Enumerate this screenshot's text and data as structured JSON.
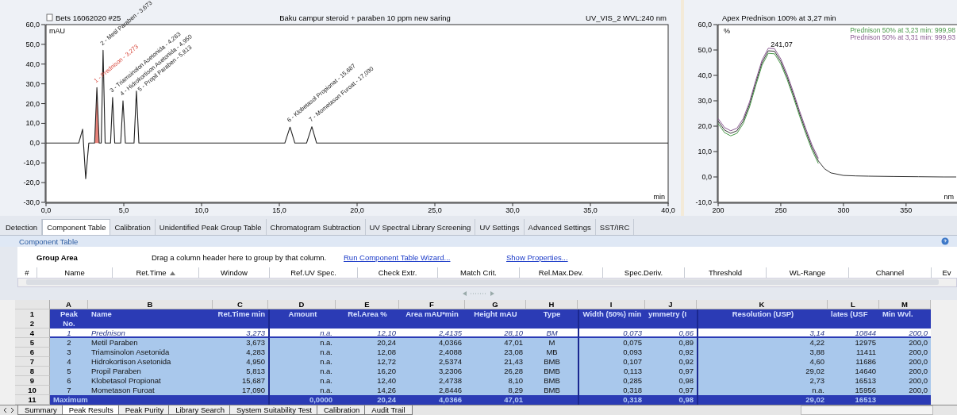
{
  "chromatogram": {
    "sample": "Bets 16062020 #25",
    "title": "Baku campur steroid + paraben 10 ppm new saring",
    "channel": "UV_VIS_2 WVL:240 nm",
    "chart_data": {
      "type": "line",
      "xlabel": "min",
      "ylabel": "mAU",
      "xlim": [
        0,
        40
      ],
      "ylim": [
        -30,
        60
      ],
      "xticks": [
        {
          "value": 0,
          "label": "0,0"
        },
        {
          "value": 5,
          "label": "5,0"
        },
        {
          "value": 10,
          "label": "10,0"
        },
        {
          "value": 15,
          "label": "15,0"
        },
        {
          "value": 20,
          "label": "20,0"
        },
        {
          "value": 25,
          "label": "25,0"
        },
        {
          "value": 30,
          "label": "30,0"
        },
        {
          "value": 35,
          "label": "35,0"
        },
        {
          "value": 40,
          "label": "40,0"
        }
      ],
      "yticks": [
        {
          "value": 60,
          "label": "60,0"
        },
        {
          "value": 50,
          "label": "50,0"
        },
        {
          "value": 40,
          "label": "40,0"
        },
        {
          "value": 30,
          "label": "30,0"
        },
        {
          "value": 20,
          "label": "20,0"
        },
        {
          "value": 10,
          "label": "10,0"
        },
        {
          "value": 0,
          "label": "0,0"
        },
        {
          "value": -10,
          "label": "-10,0"
        },
        {
          "value": -20,
          "label": "-20,0"
        },
        {
          "value": -30,
          "label": "-30,0"
        }
      ],
      "x": [
        0,
        2.1,
        2.35,
        2.55,
        2.75,
        3.12,
        3.27,
        3.42,
        3.55,
        3.67,
        3.8,
        4.15,
        4.28,
        4.42,
        4.8,
        4.95,
        5.1,
        5.66,
        5.81,
        5.97,
        15.35,
        15.69,
        16.0,
        16.75,
        17.09,
        17.4,
        40
      ],
      "series": [
        {
          "color": "#222222",
          "values": [
            0,
            0,
            7,
            -18,
            0,
            0,
            28.1,
            0,
            0,
            47.0,
            0,
            0,
            23.1,
            0,
            0,
            21.4,
            0,
            0,
            26.3,
            0,
            0,
            8.1,
            0,
            0,
            8.3,
            0,
            0
          ]
        }
      ],
      "annotations": [
        {
          "x": 3.27,
          "y": 28.1,
          "text": "1 - Prednison - 3,273"
        },
        {
          "x": 3.67,
          "y": 47.0,
          "text": "2 - Metil Paraben - 3,673"
        },
        {
          "x": 4.28,
          "y": 23.1,
          "text": "3 - Triamsinolon Asetonida - 4,283"
        },
        {
          "x": 4.95,
          "y": 21.4,
          "text": "4 - Hidrokortison Asetonida - 4,950"
        },
        {
          "x": 5.81,
          "y": 26.3,
          "text": "5 - Propil Paraben - 5,813"
        },
        {
          "x": 15.69,
          "y": 8.1,
          "text": "6 - Klobetasol Propionat - 15,687"
        },
        {
          "x": 17.09,
          "y": 8.3,
          "text": "7 - Mometason Furoat - 17,090"
        }
      ]
    },
    "peaks": [
      {
        "selected": true
      },
      {
        "selected": false
      },
      {
        "selected": false
      },
      {
        "selected": false
      },
      {
        "selected": false
      },
      {
        "selected": false
      },
      {
        "selected": false
      }
    ]
  },
  "spectrum": {
    "chart_data": {
      "type": "line",
      "title": "Apex Prednison 100% at 3,27 min",
      "xlabel": "nm",
      "ylabel": "%",
      "xlim": [
        200,
        390
      ],
      "ylim": [
        -10,
        60
      ],
      "xticks": [
        {
          "value": 200,
          "label": "200"
        },
        {
          "value": 250,
          "label": "250"
        },
        {
          "value": 300,
          "label": "300"
        },
        {
          "value": 350,
          "label": "350"
        }
      ],
      "yticks": [
        {
          "value": 60,
          "label": "60,0"
        },
        {
          "value": 50,
          "label": "50,0"
        },
        {
          "value": 40,
          "label": "40,0"
        },
        {
          "value": 30,
          "label": "30,0"
        },
        {
          "value": 20,
          "label": "20,0"
        },
        {
          "value": 10,
          "label": "10,0"
        },
        {
          "value": 0,
          "label": "0,0"
        },
        {
          "value": -10,
          "label": "-10,0"
        }
      ],
      "x": [
        200,
        205,
        210,
        215,
        220,
        225,
        230,
        235,
        240,
        245,
        250,
        255,
        260,
        265,
        270,
        275,
        280,
        285,
        290,
        300,
        310,
        320,
        340,
        360,
        380,
        390
      ],
      "series": [
        {
          "color": "#333333",
          "values": [
            22,
            18.5,
            17.2,
            18.2,
            22,
            28.5,
            37,
            45,
            49.7,
            49.5,
            45.5,
            39.5,
            32.5,
            25,
            18,
            11.5,
            6.3,
            3.2,
            1.6,
            0.6,
            0.4,
            0.3,
            0.2,
            0.1,
            0,
            0
          ]
        },
        {
          "name": "Prednison 50% at 3,23 min: 999,98",
          "color": "#4a9a4a",
          "values": [
            21,
            17.5,
            16.2,
            17.2,
            21,
            27.5,
            36,
            44,
            48.7,
            48.5,
            44.5,
            38.5,
            31.5,
            24,
            17,
            10.5,
            5.3,
            null,
            null,
            null,
            null,
            null,
            null,
            null,
            null,
            null
          ]
        },
        {
          "name": "Prednison 50% at 3,31 min: 999,93",
          "color": "#8a5a92",
          "values": [
            23,
            19.5,
            18.2,
            19.2,
            23,
            29.5,
            38,
            46,
            50.7,
            50.5,
            46.5,
            40.5,
            33.5,
            26,
            19,
            12.5,
            7.3,
            null,
            null,
            null,
            null,
            null,
            null,
            null,
            null,
            null
          ]
        }
      ],
      "annotations": [
        {
          "x": 242,
          "y": 50,
          "text": "241,07"
        }
      ]
    }
  },
  "tabs": [
    {
      "label": "Detection",
      "selected": false
    },
    {
      "label": "Component Table",
      "selected": true
    },
    {
      "label": "Calibration",
      "selected": false
    },
    {
      "label": "Unidentified Peak Group Table",
      "selected": false
    },
    {
      "label": "Chromatogram Subtraction",
      "selected": false
    },
    {
      "label": "UV Spectral Library Screening",
      "selected": false
    },
    {
      "label": "UV Settings",
      "selected": false
    },
    {
      "label": "Advanced Settings",
      "selected": false
    },
    {
      "label": "SST/IRC",
      "selected": false
    }
  ],
  "component_table": {
    "title": "Component Table",
    "group_area": "Group Area",
    "group_hint": "Drag a column header here to group by that column.",
    "links": [
      "Run Component Table Wizard...",
      "Show Properties..."
    ],
    "columns": [
      {
        "label": "#",
        "sorted": false
      },
      {
        "label": "Name",
        "sorted": false
      },
      {
        "label": "Ret.Time",
        "sorted": true
      },
      {
        "label": "Window",
        "sorted": false
      },
      {
        "label": "Ref.UV Spec.",
        "sorted": false
      },
      {
        "label": "Check Extr.",
        "sorted": false
      },
      {
        "label": "Match Crit.",
        "sorted": false
      },
      {
        "label": "Rel.Max.Dev.",
        "sorted": false
      },
      {
        "label": "Spec.Deriv.",
        "sorted": false
      },
      {
        "label": "Threshold",
        "sorted": false
      },
      {
        "label": "WL-Range",
        "sorted": false
      },
      {
        "label": "Channel",
        "sorted": false
      },
      {
        "label": "Ev",
        "sorted": false
      }
    ]
  },
  "results": {
    "column_letters": [
      "A",
      "B",
      "C",
      "D",
      "E",
      "F",
      "G",
      "H",
      "I",
      "J",
      "K",
      "L",
      "M"
    ],
    "header_row_numbers": [
      "1",
      "2"
    ],
    "headers": [
      [
        "Peak",
        "No."
      ],
      [
        "Name"
      ],
      [
        "Ret.Time",
        "min"
      ],
      [
        "Amount"
      ],
      [
        "Rel.Area",
        "%"
      ],
      [
        "Area",
        "mAU*min"
      ],
      [
        "Height",
        "mAU"
      ],
      [
        "Type"
      ],
      [
        "Width (50%)",
        "min"
      ],
      [
        "ymmetry (I"
      ],
      [
        "Resolution (USP)"
      ],
      [
        "lates (USF"
      ],
      [
        "Min Wvl."
      ]
    ],
    "rows": [
      {
        "number": "4",
        "selected": true,
        "cells": [
          "1",
          "Prednison",
          "3,273",
          "n.a.",
          "12,10",
          "2,4135",
          "28,10",
          "BM",
          "0,073",
          "0,86",
          "3,14",
          "10844",
          "200,0"
        ]
      },
      {
        "number": "5",
        "selected": false,
        "cells": [
          "2",
          "Metil Paraben",
          "3,673",
          "n.a.",
          "20,24",
          "4,0366",
          "47,01",
          "M",
          "0,075",
          "0,89",
          "4,22",
          "12975",
          "200,0"
        ]
      },
      {
        "number": "6",
        "selected": false,
        "cells": [
          "3",
          "Triamsinolon Asetonida",
          "4,283",
          "n.a.",
          "12,08",
          "2,4088",
          "23,08",
          "MB",
          "0,093",
          "0,92",
          "3,88",
          "11411",
          "200,0"
        ]
      },
      {
        "number": "7",
        "selected": false,
        "cells": [
          "4",
          "Hidrokortison Asetonida",
          "4,950",
          "n.a.",
          "12,72",
          "2,5374",
          "21,43",
          "BMB",
          "0,107",
          "0,92",
          "4,60",
          "11686",
          "200,0"
        ]
      },
      {
        "number": "8",
        "selected": false,
        "cells": [
          "5",
          "Propil Paraben",
          "5,813",
          "n.a.",
          "16,20",
          "3,2306",
          "26,28",
          "BMB",
          "0,113",
          "0,97",
          "29,02",
          "14640",
          "200,0"
        ]
      },
      {
        "number": "9",
        "selected": false,
        "cells": [
          "6",
          "Klobetasol Propionat",
          "15,687",
          "n.a.",
          "12,40",
          "2,4738",
          "8,10",
          "BMB",
          "0,285",
          "0,98",
          "2,73",
          "16513",
          "200,0"
        ]
      },
      {
        "number": "10",
        "selected": false,
        "cells": [
          "7",
          "Mometason Furoat",
          "17,090",
          "n.a.",
          "14,26",
          "2,8446",
          "8,29",
          "BMB",
          "0,318",
          "0,97",
          "n.a.",
          "15956",
          "200,0"
        ]
      }
    ],
    "maximum": {
      "number": "11",
      "label": "Maximum",
      "cells": {
        "D": "0,0000",
        "E": "20,24",
        "F": "4,0366",
        "G": "47,01",
        "I": "0,318",
        "J": "0,98",
        "K": "29,02",
        "L": "16513"
      }
    }
  },
  "sheet_tabs": [
    {
      "label": "Summary",
      "selected": false
    },
    {
      "label": "Peak Results",
      "selected": true
    },
    {
      "label": "Peak Purity",
      "selected": false
    },
    {
      "label": "Library Search",
      "selected": false
    },
    {
      "label": "System Suitability Test",
      "selected": false
    },
    {
      "label": "Calibration",
      "selected": false
    },
    {
      "label": "Audit Trail",
      "selected": false
    }
  ]
}
